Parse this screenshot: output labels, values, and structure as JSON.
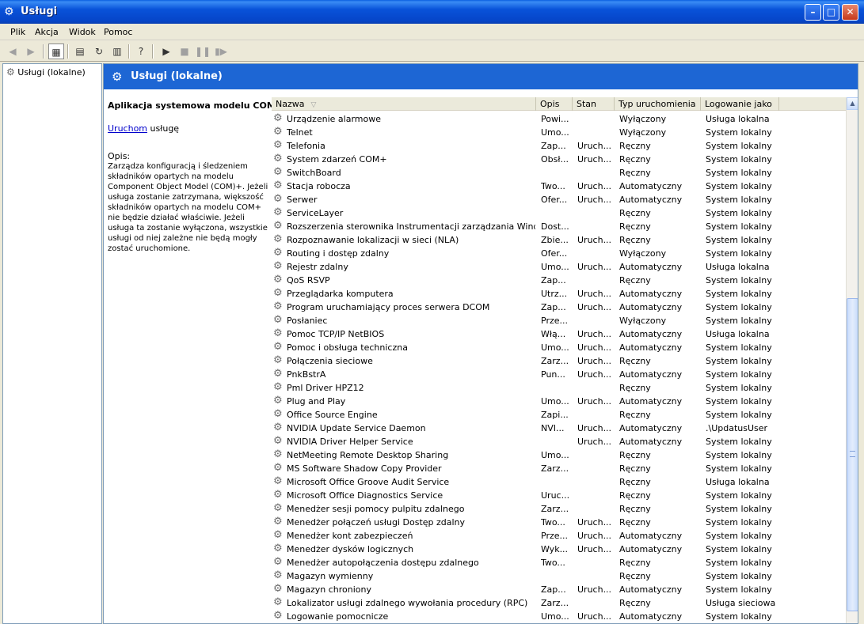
{
  "window": {
    "title": "Usługi",
    "min_glyph": "–",
    "max_glyph": "□",
    "close_glyph": "✕"
  },
  "menu": [
    "Plik",
    "Akcja",
    "Widok",
    "Pomoc"
  ],
  "tree": {
    "root_label": "Usługi (lokalne)"
  },
  "pane": {
    "header_title": "Usługi (lokalne)"
  },
  "details": {
    "service_name": "Aplikacja systemowa modelu COM+",
    "start_link": "Uruchom",
    "start_suffix": " usługę",
    "desc_label": "Opis:",
    "desc_lines": [
      "Zarządza konfiguracją i śledzeniem",
      "składników opartych na modelu",
      "Component Object Model (COM)+. Jeżeli",
      "usługa zostanie zatrzymana, większość",
      "składników opartych na modelu COM+",
      "nie będzie działać właściwie. Jeżeli",
      "usługa ta zostanie wyłączona, wszystkie",
      "usługi od niej zależne nie będą mogły",
      "zostać uruchomione."
    ]
  },
  "columns": {
    "name": "Nazwa",
    "desc": "Opis",
    "status": "Stan",
    "startup": "Typ uruchomienia",
    "logon": "Logowanie jako",
    "sort_indicator": "▽"
  },
  "services": [
    [
      "Urządzenie alarmowe",
      "Powi...",
      "",
      "Wyłączony",
      "Usługa lokalna"
    ],
    [
      "Telnet",
      "Umo...",
      "",
      "Wyłączony",
      "System lokalny"
    ],
    [
      "Telefonia",
      "Zap...",
      "Uruch...",
      "Ręczny",
      "System lokalny"
    ],
    [
      "System zdarzeń COM+",
      "Obsł...",
      "Uruch...",
      "Ręczny",
      "System lokalny"
    ],
    [
      "SwitchBoard",
      "",
      "",
      "Ręczny",
      "System lokalny"
    ],
    [
      "Stacja robocza",
      "Two...",
      "Uruch...",
      "Automatyczny",
      "System lokalny"
    ],
    [
      "Serwer",
      "Ofer...",
      "Uruch...",
      "Automatyczny",
      "System lokalny"
    ],
    [
      "ServiceLayer",
      "",
      "",
      "Ręczny",
      "System lokalny"
    ],
    [
      "Rozszerzenia sterownika Instrumentacji zarządzania Windows",
      "Dost...",
      "",
      "Ręczny",
      "System lokalny"
    ],
    [
      "Rozpoznawanie lokalizacji w sieci (NLA)",
      "Zbie...",
      "Uruch...",
      "Ręczny",
      "System lokalny"
    ],
    [
      "Routing i dostęp zdalny",
      "Ofer...",
      "",
      "Wyłączony",
      "System lokalny"
    ],
    [
      "Rejestr zdalny",
      "Umo...",
      "Uruch...",
      "Automatyczny",
      "Usługa lokalna"
    ],
    [
      "QoS RSVP",
      "Zap...",
      "",
      "Ręczny",
      "System lokalny"
    ],
    [
      "Przeglądarka komputera",
      "Utrz...",
      "Uruch...",
      "Automatyczny",
      "System lokalny"
    ],
    [
      "Program uruchamiający proces serwera DCOM",
      "Zap...",
      "Uruch...",
      "Automatyczny",
      "System lokalny"
    ],
    [
      "Posłaniec",
      "Prze...",
      "",
      "Wyłączony",
      "System lokalny"
    ],
    [
      "Pomoc TCP/IP NetBIOS",
      "Włą...",
      "Uruch...",
      "Automatyczny",
      "Usługa lokalna"
    ],
    [
      "Pomoc i obsługa techniczna",
      "Umo...",
      "Uruch...",
      "Automatyczny",
      "System lokalny"
    ],
    [
      "Połączenia sieciowe",
      "Zarz...",
      "Uruch...",
      "Ręczny",
      "System lokalny"
    ],
    [
      "PnkBstrA",
      "Pun...",
      "Uruch...",
      "Automatyczny",
      "System lokalny"
    ],
    [
      "Pml Driver HPZ12",
      "",
      "",
      "Ręczny",
      "System lokalny"
    ],
    [
      "Plug and Play",
      "Umo...",
      "Uruch...",
      "Automatyczny",
      "System lokalny"
    ],
    [
      "Office Source Engine",
      "Zapi...",
      "",
      "Ręczny",
      "System lokalny"
    ],
    [
      "NVIDIA Update Service Daemon",
      "NVI...",
      "Uruch...",
      "Automatyczny",
      ".\\UpdatusUser"
    ],
    [
      "NVIDIA Driver Helper Service",
      "",
      "Uruch...",
      "Automatyczny",
      "System lokalny"
    ],
    [
      "NetMeeting Remote Desktop Sharing",
      "Umo...",
      "",
      "Ręczny",
      "System lokalny"
    ],
    [
      "MS Software Shadow Copy Provider",
      "Zarz...",
      "",
      "Ręczny",
      "System lokalny"
    ],
    [
      "Microsoft Office Groove Audit Service",
      "",
      "",
      "Ręczny",
      "Usługa lokalna"
    ],
    [
      "Microsoft Office Diagnostics Service",
      "Uruc...",
      "",
      "Ręczny",
      "System lokalny"
    ],
    [
      "Menedżer sesji pomocy pulpitu zdalnego",
      "Zarz...",
      "",
      "Ręczny",
      "System lokalny"
    ],
    [
      "Menedżer połączeń usługi Dostęp zdalny",
      "Two...",
      "Uruch...",
      "Ręczny",
      "System lokalny"
    ],
    [
      "Menedżer kont zabezpieczeń",
      "Prze...",
      "Uruch...",
      "Automatyczny",
      "System lokalny"
    ],
    [
      "Menedżer dysków logicznych",
      "Wyk...",
      "Uruch...",
      "Automatyczny",
      "System lokalny"
    ],
    [
      "Menedżer autopołączenia dostępu zdalnego",
      "Two...",
      "",
      "Ręczny",
      "System lokalny"
    ],
    [
      "Magazyn wymienny",
      "",
      "",
      "Ręczny",
      "System lokalny"
    ],
    [
      "Magazyn chroniony",
      "Zap...",
      "Uruch...",
      "Automatyczny",
      "System lokalny"
    ],
    [
      "Lokalizator usługi zdalnego wywołania procedury (RPC)",
      "Zarz...",
      "",
      "Ręczny",
      "Usługa sieciowa"
    ],
    [
      "Logowanie pomocnicze",
      "Umo...",
      "Uruch...",
      "Automatyczny",
      "System lokalny"
    ]
  ]
}
